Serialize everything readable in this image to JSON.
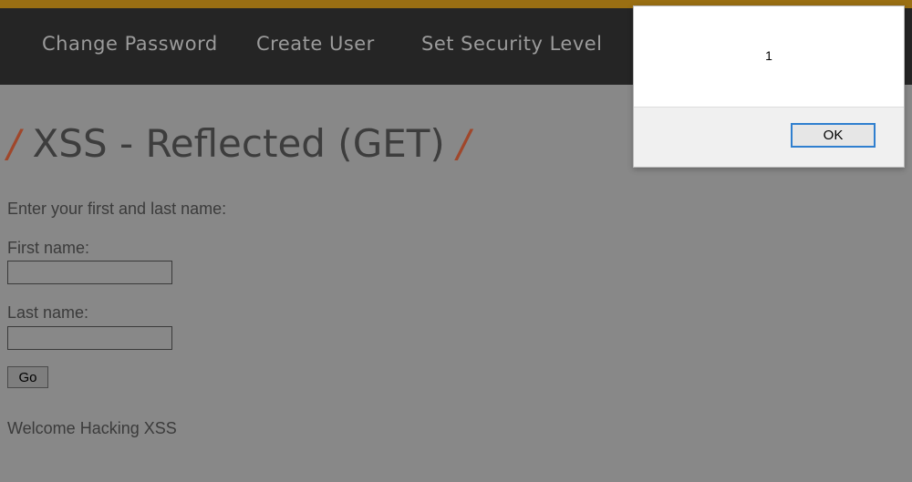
{
  "nav": {
    "items": [
      {
        "label": "Change Password"
      },
      {
        "label": "Create User"
      },
      {
        "label": "Set Security Level"
      }
    ]
  },
  "page": {
    "title_slash_left": "/",
    "title": "XSS - Reflected (GET)",
    "title_slash_right": "/",
    "intro": "Enter your first and last name:",
    "first_name_label": "First name:",
    "first_name_value": "",
    "last_name_label": "Last name:",
    "last_name_value": "",
    "go_label": "Go",
    "welcome": "Welcome Hacking XSS"
  },
  "alert": {
    "message": "1",
    "ok_label": "OK"
  },
  "colors": {
    "accent_stripe": "#9a6f13",
    "navbar_bg": "#252525",
    "title_slash": "#a0472b",
    "dialog_ok_border": "#2f7fcf"
  }
}
